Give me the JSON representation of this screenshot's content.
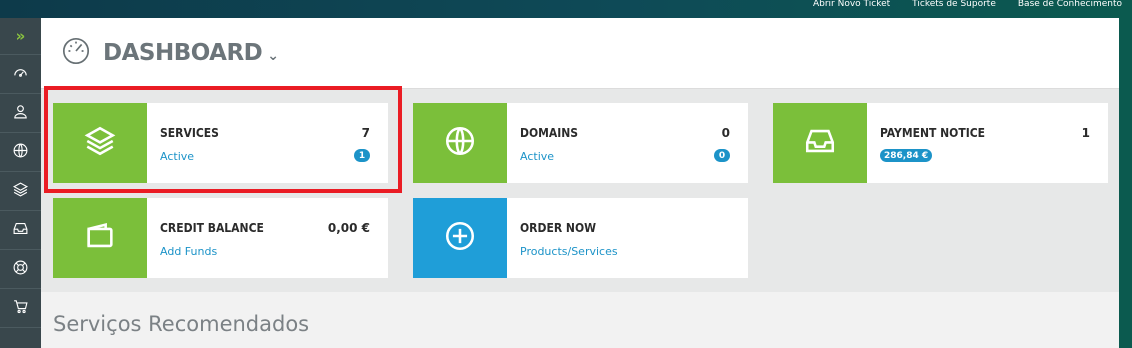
{
  "top_links": [
    "Abrir Novo Ticket",
    "Tickets de Suporte",
    "Base de Conhecimento"
  ],
  "sidebar": {
    "toggle_glyph": "»",
    "items": [
      {
        "icon": "gauge-icon"
      },
      {
        "icon": "user-icon"
      },
      {
        "icon": "globe-icon"
      },
      {
        "icon": "layers-icon"
      },
      {
        "icon": "inbox-icon"
      },
      {
        "icon": "lifebuoy-icon"
      },
      {
        "icon": "cart-icon"
      }
    ]
  },
  "header": {
    "title": "DASHBOARD",
    "chevron": "⌄"
  },
  "cards": {
    "services": {
      "title": "SERVICES",
      "count": "7",
      "sub": "Active",
      "badge": "1"
    },
    "domains": {
      "title": "DOMAINS",
      "count": "0",
      "sub": "Active",
      "badge": "0"
    },
    "payment": {
      "title": "PAYMENT NOTICE",
      "count": "1",
      "badge": "286,84 €"
    },
    "credit": {
      "title": "CREDIT BALANCE",
      "count": "0,00 €",
      "sub": "Add Funds"
    },
    "order": {
      "title": "ORDER NOW",
      "sub": "Products/Services"
    }
  },
  "recommended": {
    "title": "Serviços Recomendados"
  },
  "colors": {
    "green": "#7bbf3a",
    "blue": "#1f9ed8",
    "link": "#1c93c8",
    "highlight": "#ea1c24",
    "sidebar": "#39474c"
  }
}
